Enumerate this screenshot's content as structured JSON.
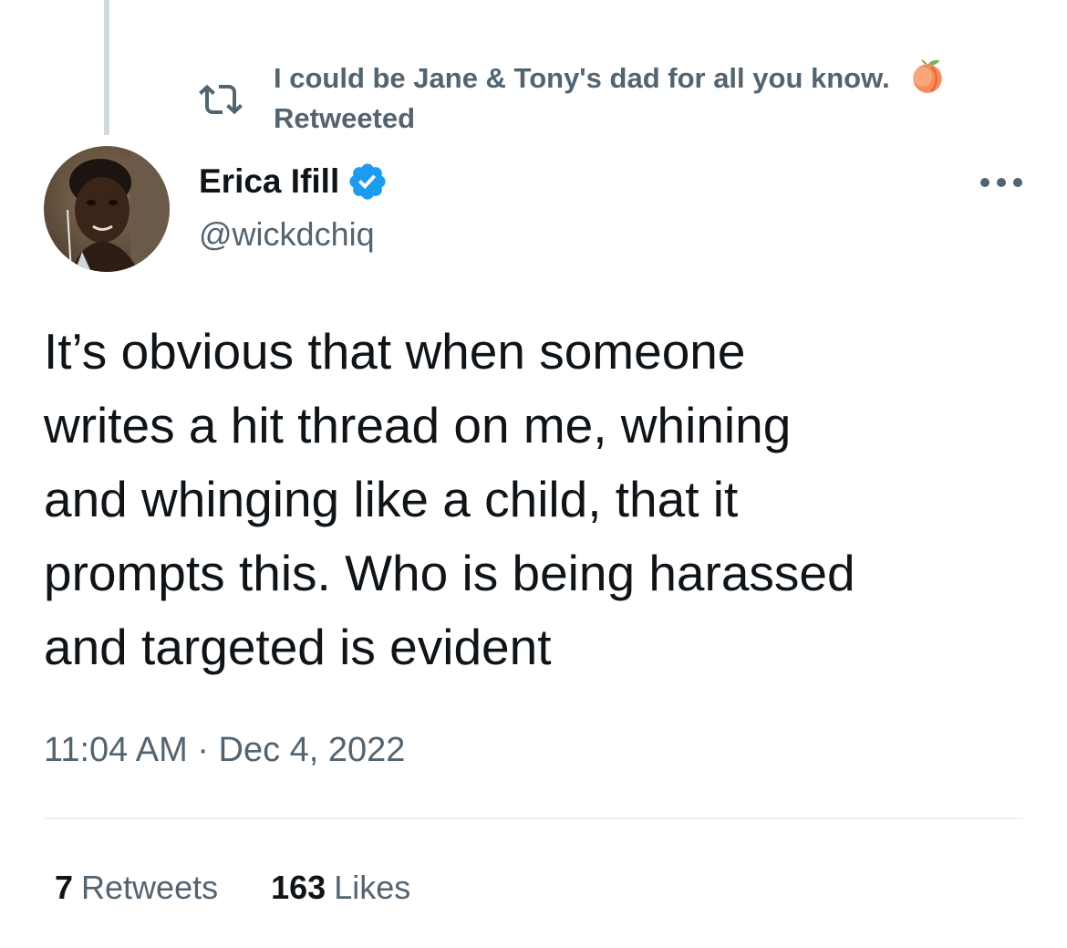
{
  "social_context": {
    "icon": "retweet-icon",
    "retweeter_name": "I could be Jane & Tony's dad for all you know.",
    "retweeter_emoji_icon": "peach-emoji-icon",
    "action": "Retweeted"
  },
  "tweet": {
    "author": {
      "name": "Erica Ifill",
      "handle": "@wickdchiq",
      "verified": true,
      "verified_icon": "verified-badge-icon",
      "avatar_icon": "avatar"
    },
    "more_icon": "more-options-icon",
    "text_lines": [
      "It’s obvious that when someone",
      "writes a hit thread on me, whining",
      "and whinging like a child, that it",
      "prompts this. Who is being harassed",
      "and targeted is evident"
    ],
    "timestamp": "11:04 AM · Dec 4, 2022",
    "stats": {
      "retweets_count": "7",
      "retweets_label": "Retweets",
      "likes_count": "163",
      "likes_label": "Likes"
    }
  },
  "colors": {
    "text_primary": "#0f1419",
    "text_secondary": "#536471",
    "verified_blue": "#1d9bf0",
    "divider": "#eff3f4",
    "thread_line": "#cfd9de"
  }
}
